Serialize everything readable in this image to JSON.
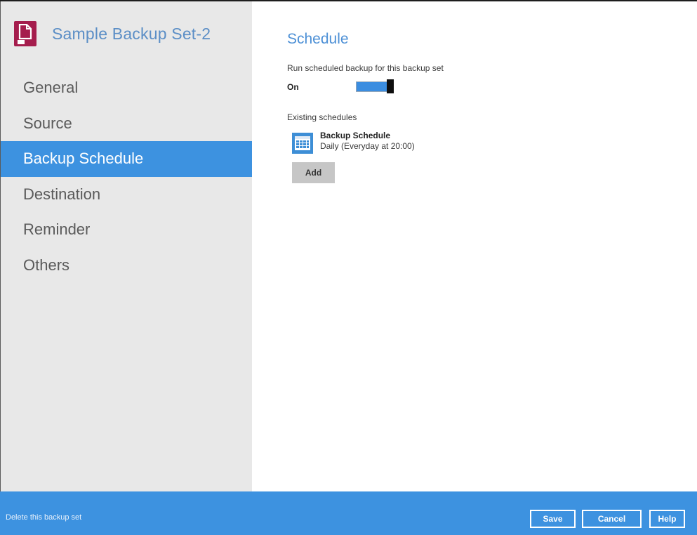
{
  "sidebar": {
    "set_title": "Sample Backup Set-2",
    "set_icon": "file-backup-set-icon",
    "items": [
      {
        "label": "General"
      },
      {
        "label": "Source"
      },
      {
        "label": "Backup Schedule",
        "active": true
      },
      {
        "label": "Destination"
      },
      {
        "label": "Reminder"
      },
      {
        "label": "Others"
      }
    ]
  },
  "main": {
    "title": "Schedule",
    "run_scheduled_label": "Run scheduled backup for this backup set",
    "toggle_state_label": "On",
    "existing_schedules_label": "Existing schedules",
    "schedules": [
      {
        "icon": "calendar-icon",
        "name": "Backup Schedule",
        "description": "Daily (Everyday at 20:00)"
      }
    ],
    "add_label": "Add"
  },
  "footer": {
    "delete_label": "Delete this backup set",
    "save_label": "Save",
    "cancel_label": "Cancel",
    "help_label": "Help"
  },
  "colors": {
    "accent": "#3d92e0",
    "title_blue": "#4d90d6",
    "sidebar_bg": "#e8e8e8",
    "set_icon_bg": "#a51d4d"
  }
}
